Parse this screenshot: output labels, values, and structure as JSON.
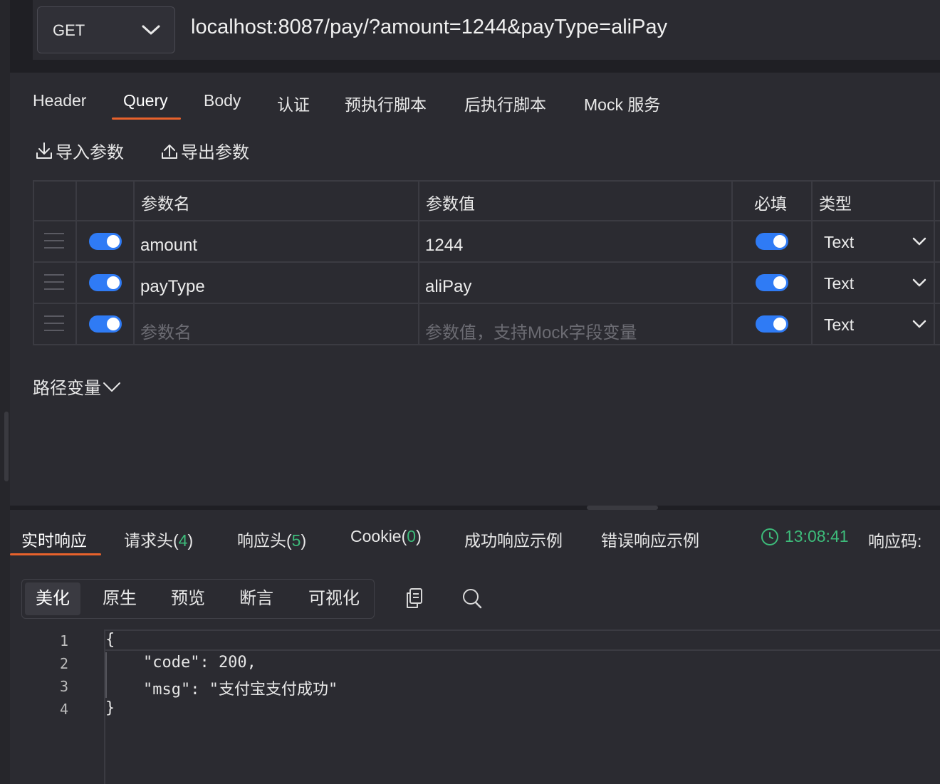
{
  "request": {
    "method": "GET",
    "url": "localhost:8087/pay/?amount=1244&payType=aliPay"
  },
  "tabs": [
    {
      "label": "Header"
    },
    {
      "label": "Query"
    },
    {
      "label": "Body"
    },
    {
      "label": "认证"
    },
    {
      "label": "预执行脚本"
    },
    {
      "label": "后执行脚本"
    },
    {
      "label": "Mock 服务"
    }
  ],
  "active_tab": "Query",
  "actions": {
    "import_label": "导入参数",
    "export_label": "导出参数"
  },
  "params_table": {
    "headers": {
      "name": "参数名",
      "value": "参数值",
      "required": "必填",
      "type": "类型"
    },
    "rows": [
      {
        "enabled": true,
        "name": "amount",
        "value": "1244",
        "required": true,
        "type": "Text"
      },
      {
        "enabled": true,
        "name": "payType",
        "value": "aliPay",
        "required": true,
        "type": "Text"
      }
    ],
    "new_row": {
      "enabled": true,
      "name_placeholder": "参数名",
      "value_placeholder": "参数值，支持Mock字段变量",
      "required": true,
      "type": "Text"
    }
  },
  "path_variables": {
    "label": "路径变量"
  },
  "response": {
    "tabs": [
      {
        "label": "实时响应"
      },
      {
        "label": "请求头(",
        "count": "4",
        "suffix": ")"
      },
      {
        "label": "响应头(",
        "count": "5",
        "suffix": ")"
      },
      {
        "label": "Cookie(",
        "count": "0",
        "suffix": ")"
      },
      {
        "label": "成功响应示例"
      },
      {
        "label": "错误响应示例"
      }
    ],
    "active_tab": "实时响应",
    "time": "13:08:41",
    "status_label": "响应码:",
    "view_modes": [
      "美化",
      "原生",
      "预览",
      "断言",
      "可视化"
    ],
    "active_view": "美化",
    "code_lines": [
      {
        "num": "1",
        "text": "{"
      },
      {
        "num": "2",
        "text": "    \"code\": 200,"
      },
      {
        "num": "3",
        "text": "    \"msg\": \"支付宝支付成功\""
      },
      {
        "num": "4",
        "text": "}"
      }
    ]
  },
  "colors": {
    "accent": "#e8622c",
    "toggle_on": "#2f7bf5",
    "success": "#3dbb7a",
    "panel_bg": "#2b2b31",
    "page_bg": "#1f1f24"
  }
}
